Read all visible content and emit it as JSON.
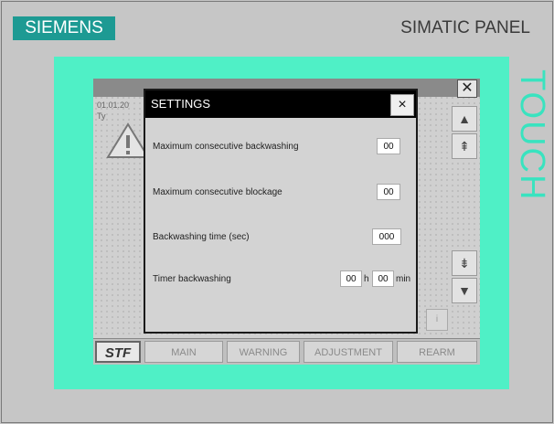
{
  "header": {
    "brand": "SIEMENS",
    "panel_name": "SIMATIC PANEL",
    "touch_label": "TOUCH"
  },
  "screen": {
    "date_text": "01.01.20",
    "ty_text": "Ty",
    "info_label": "i"
  },
  "side_buttons": [
    {
      "icon": "arrow-up-icon",
      "glyph": "▲"
    },
    {
      "icon": "double-arrow-up-icon",
      "glyph": "⇞"
    },
    {
      "icon": "double-arrow-down-icon",
      "glyph": "⇟"
    },
    {
      "icon": "arrow-down-icon",
      "glyph": "▼"
    }
  ],
  "bottom_bar": {
    "stf": "STF",
    "buttons": [
      "MAIN",
      "WARNING",
      "ADJUSTMENT",
      "REARM"
    ]
  },
  "dialog": {
    "title": "SETTINGS",
    "close_label": "×",
    "rows": {
      "max_backwashing": {
        "label": "Maximum consecutive backwashing",
        "value": "00"
      },
      "max_blockage": {
        "label": "Maximum consecutive blockage",
        "value": "00"
      },
      "backwashing_time": {
        "label": "Backwashing time (sec)",
        "value": "000"
      },
      "timer_backwashing": {
        "label": "Timer backwashing",
        "hours": "00",
        "hours_unit": "h",
        "minutes": "00",
        "minutes_unit": "min"
      }
    }
  },
  "colors": {
    "brand": "#1d9a93",
    "bezel": "#4ff0c6",
    "touch_text": "#39e3bf",
    "dialog_titlebar": "#000000"
  }
}
